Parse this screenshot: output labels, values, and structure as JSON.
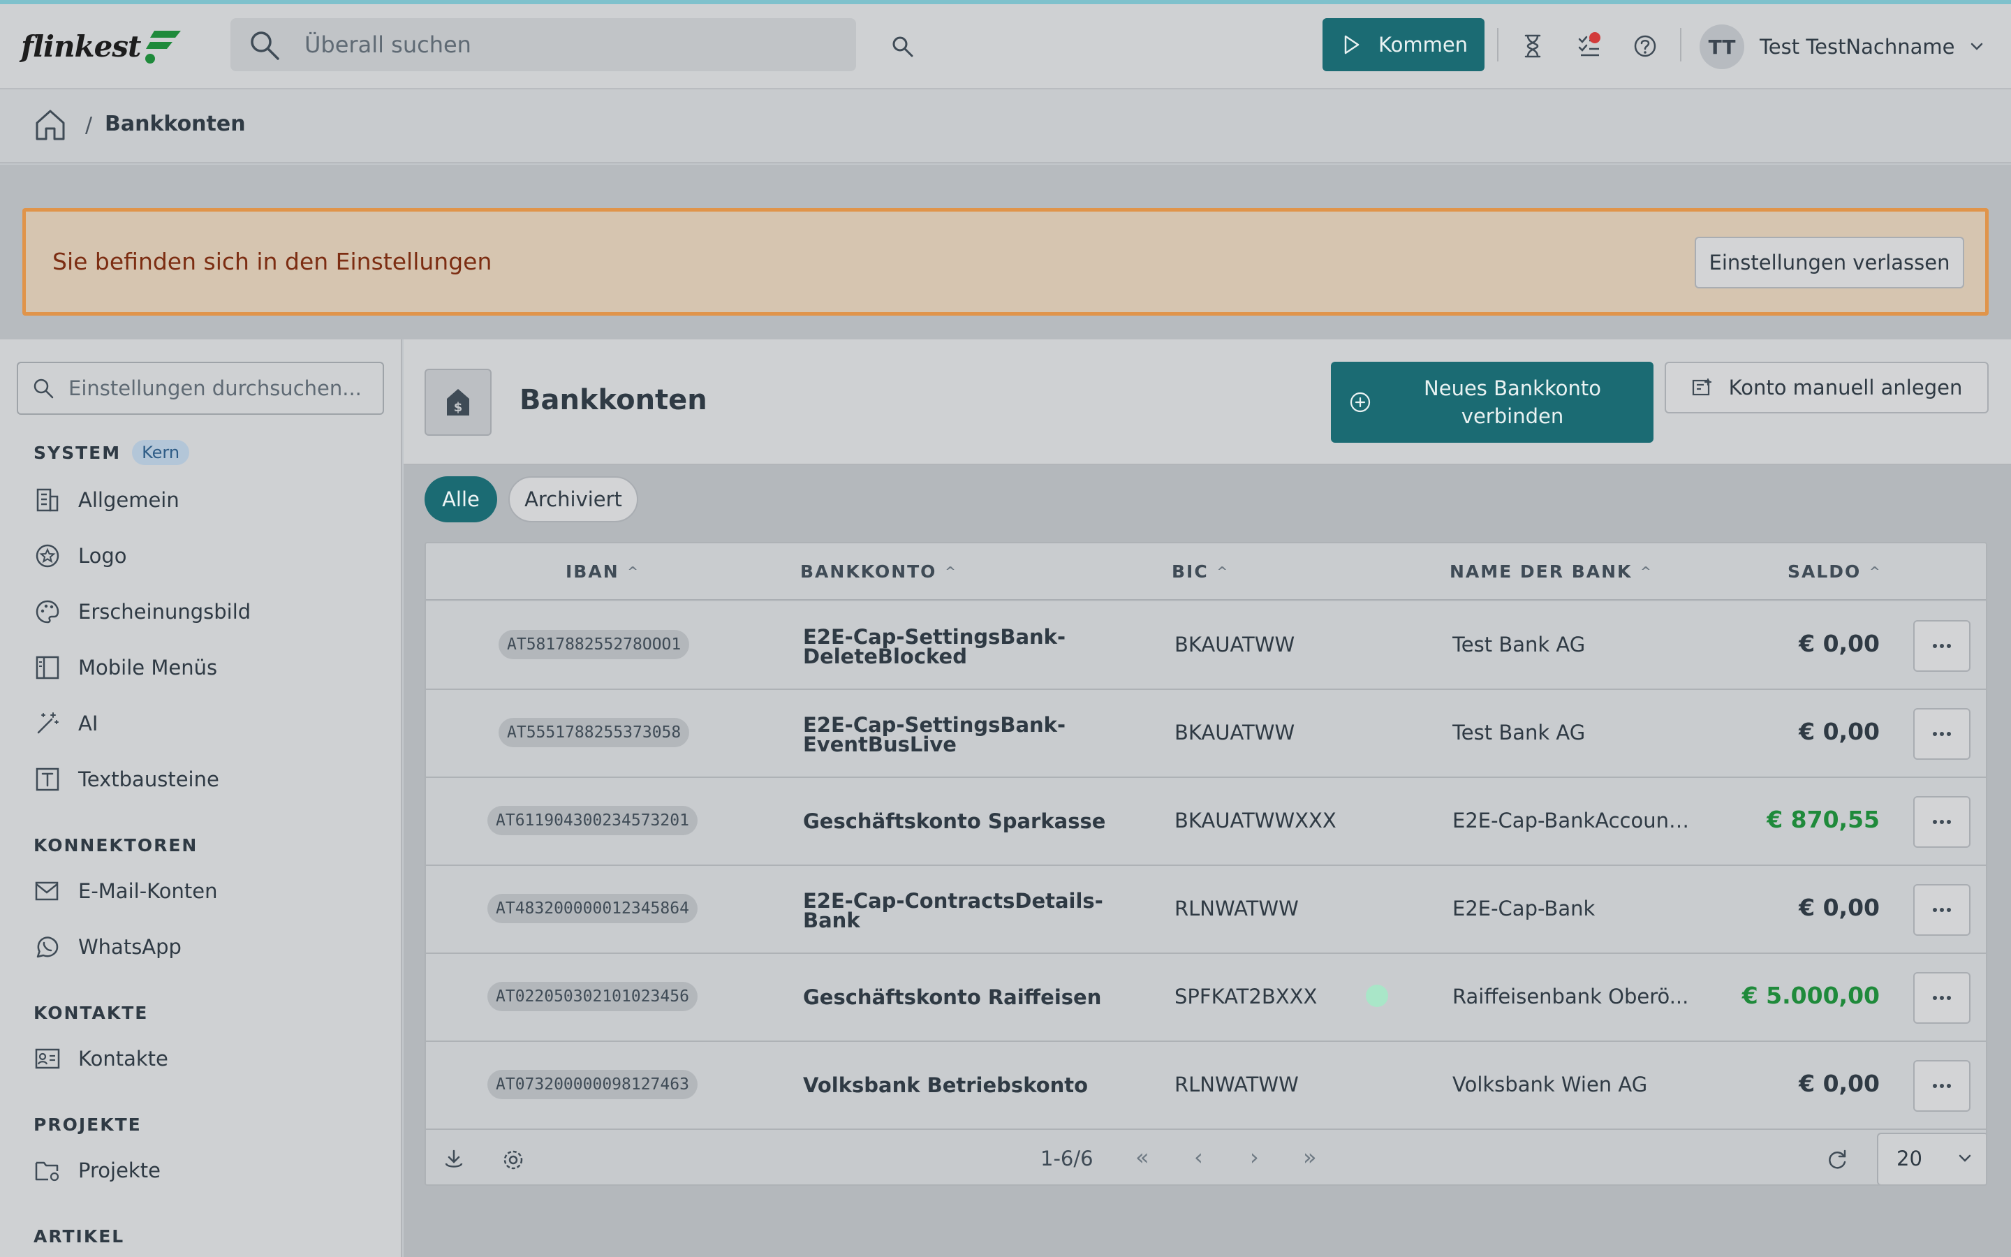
{
  "app": {
    "brand": "flinkest"
  },
  "header": {
    "search_placeholder": "Überall suchen",
    "kommen_label": "Kommen",
    "user_initials": "TT",
    "user_name": "Test TestNachname"
  },
  "breadcrumb": {
    "current": "Bankkonten",
    "separator": "/"
  },
  "banner": {
    "text": "Sie befinden sich in den Einstellungen",
    "button": "Einstellungen verlassen"
  },
  "sidebar": {
    "search_placeholder": "Einstellungen durchsuchen...",
    "sections": [
      {
        "title": "SYSTEM",
        "badge": "Kern"
      },
      {
        "title": "KONNEKTOREN"
      },
      {
        "title": "KONTAKTE"
      },
      {
        "title": "PROJEKTE"
      },
      {
        "title": "ARTIKEL"
      }
    ],
    "items": [
      {
        "label": "Allgemein",
        "icon": "building-icon"
      },
      {
        "label": "Logo",
        "icon": "badge-star-icon"
      },
      {
        "label": "Erscheinungsbild",
        "icon": "palette-icon"
      },
      {
        "label": "Mobile Menüs",
        "icon": "layout-sidebar-icon"
      },
      {
        "label": "AI",
        "icon": "magic-wand-icon"
      },
      {
        "label": "Textbausteine",
        "icon": "text-box-icon"
      },
      {
        "label": "E-Mail-Konten",
        "icon": "mail-icon"
      },
      {
        "label": "WhatsApp",
        "icon": "whatsapp-icon"
      },
      {
        "label": "Kontakte",
        "icon": "contact-card-icon"
      },
      {
        "label": "Projekte",
        "icon": "folder-settings-icon"
      }
    ]
  },
  "page": {
    "title": "Bankkonten",
    "new_button": "Neues Bankkonto verbinden",
    "manual_button": "Konto manuell anlegen",
    "tabs": [
      {
        "label": "Alle",
        "active": true
      },
      {
        "label": "Archiviert",
        "active": false
      }
    ]
  },
  "table": {
    "columns": [
      "IBAN",
      "BANKKONTO",
      "BIC",
      "NAME DER BANK",
      "SALDO"
    ],
    "rows": [
      {
        "iban": "AT581788255278OOO1",
        "konto": "E2E-Cap-SettingsBank-DeleteBlocked",
        "bic": "BKAUATWW",
        "bank": "Test Bank AG",
        "saldo": "€ 0,00",
        "positive": false
      },
      {
        "iban": "AT5551788255373058",
        "konto": "E2E-Cap-SettingsBank-EventBusLive",
        "bic": "BKAUATWW",
        "bank": "Test Bank AG",
        "saldo": "€ 0,00",
        "positive": false
      },
      {
        "iban": "AT611904300234573201",
        "konto": "Geschäftskonto Sparkasse",
        "bic": "BKAUATWWXXX",
        "bank": "E2E-Cap-BankAccount...",
        "saldo": "€ 870,55",
        "positive": true
      },
      {
        "iban": "AT483200000012345864",
        "konto": "E2E-Cap-ContractsDetails-Bank",
        "bic": "RLNWATWW",
        "bank": "E2E-Cap-Bank",
        "saldo": "€ 0,00",
        "positive": false
      },
      {
        "iban": "AT022050302101023456",
        "konto": "Geschäftskonto Raiffeisen",
        "bic": "SPFKAT2BXXX",
        "bank": "Raiffeisenbank Oberö...",
        "saldo": "€ 5.000,00",
        "positive": true
      },
      {
        "iban": "AT073200000098127463",
        "konto": "Volksbank Betriebskonto",
        "bic": "RLNWATWW",
        "bank": "Volksbank Wien AG",
        "saldo": "€ 0,00",
        "positive": false
      }
    ],
    "pagination": "1-6/6",
    "page_size": "20"
  },
  "colors": {
    "accent": "#1b6b73",
    "positive": "#1f8a3b",
    "warning_border": "#e0944a"
  }
}
